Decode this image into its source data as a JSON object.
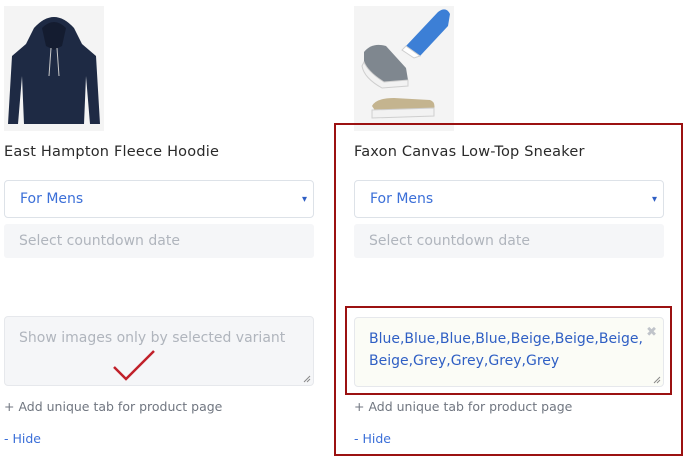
{
  "products": [
    {
      "title": "East Hampton Fleece Hoodie",
      "image": "navy-hoodie",
      "select_value": "For Mens",
      "date_placeholder": "Select countdown date",
      "variant_placeholder": "Show images only by selected variant",
      "variant_value": "",
      "add_tab_label": "+ Add unique tab for product page",
      "hide_label": "- Hide"
    },
    {
      "title": "Faxon Canvas Low-Top Sneaker",
      "image": "sneakers",
      "select_value": "For Mens",
      "date_placeholder": "Select countdown date",
      "variant_placeholder": "",
      "variant_value": "Blue,Blue,Blue,Blue,Beige,Beige,Beige,Beige,Grey,Grey,Grey,Grey",
      "add_tab_label": "+ Add unique tab for product page",
      "hide_label": "- Hide"
    }
  ],
  "icons": {
    "select_caret": "▾",
    "clear": "✖"
  },
  "colors": {
    "link": "#3b6fd8",
    "highlight_outline": "#9b1111",
    "annotation_check": "#c0202a"
  }
}
